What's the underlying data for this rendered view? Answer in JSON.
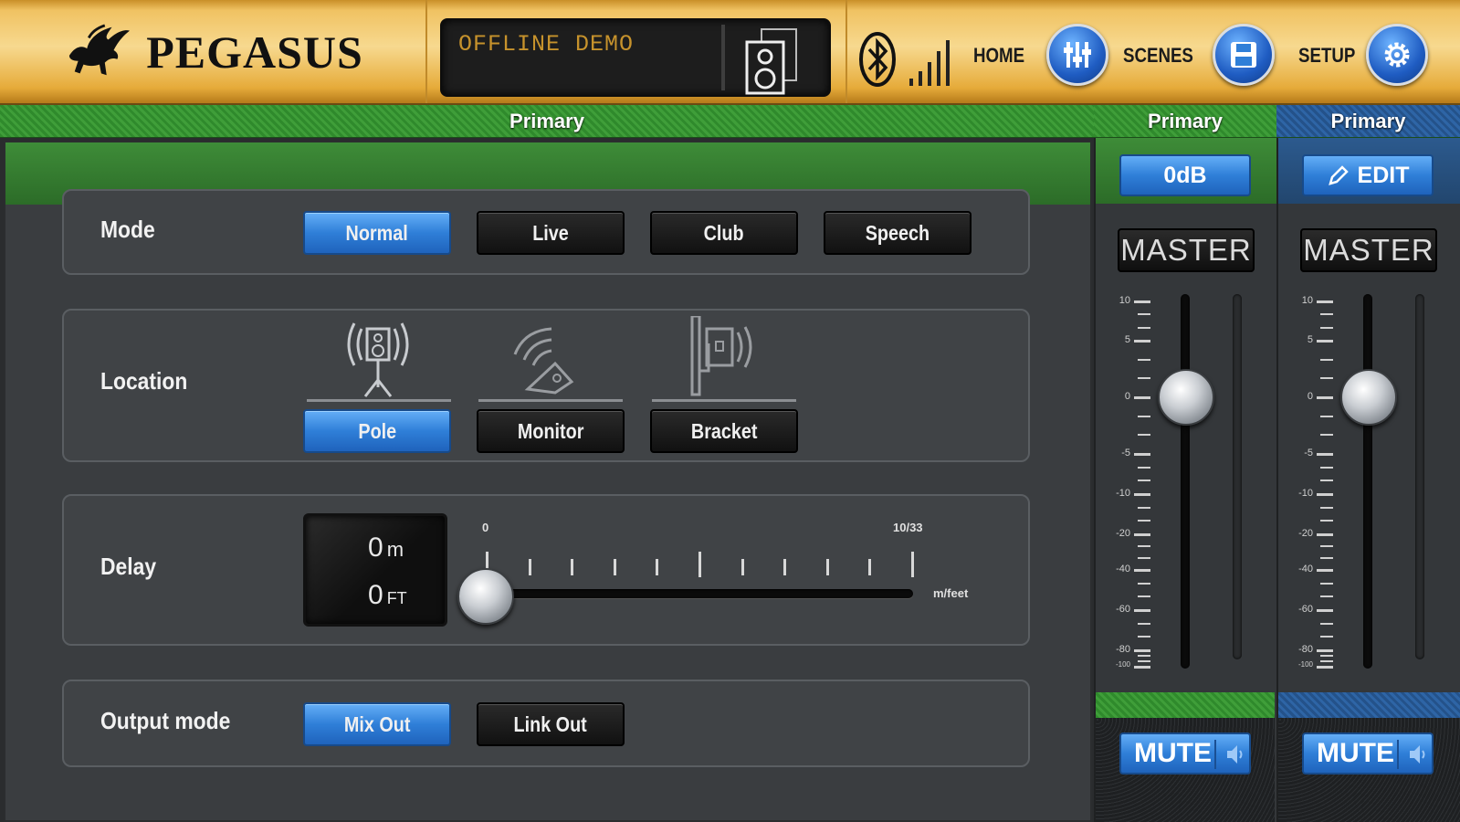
{
  "header": {
    "brand": "PEGASUS",
    "status": "OFFLINE DEMO",
    "nav": [
      {
        "label": "HOME",
        "icon": "faders-icon"
      },
      {
        "label": "SCENES",
        "icon": "floppy-icon"
      },
      {
        "label": "SETUP",
        "icon": "gear-icon"
      }
    ]
  },
  "channels": {
    "main_label": "Primary",
    "strip1_label": "Primary",
    "strip2_label": "Primary"
  },
  "sections": {
    "mode": {
      "label": "Mode",
      "options": [
        "Normal",
        "Live",
        "Club",
        "Speech"
      ],
      "selected": "Normal"
    },
    "location": {
      "label": "Location",
      "options": [
        "Pole",
        "Monitor",
        "Bracket"
      ],
      "selected": "Pole"
    },
    "delay": {
      "label": "Delay",
      "meters_value": "0",
      "meters_unit": "m",
      "feet_value": "0",
      "feet_unit": "FT",
      "slider_min": "0",
      "slider_max": "10/33",
      "slider_unit": "m/feet",
      "slider_value": 0
    },
    "output": {
      "label": "Output mode",
      "options": [
        "Mix Out",
        "Link Out"
      ],
      "selected": "Mix Out"
    }
  },
  "master_strips": [
    {
      "top_button": "0dB",
      "name": "MASTER",
      "mute": "MUTE",
      "fader_db": 0,
      "color": "#3f9e39"
    },
    {
      "top_button": "EDIT",
      "name": "MASTER",
      "mute": "MUTE",
      "fader_db": 0,
      "color": "#2e65a6"
    }
  ],
  "fader_scale": [
    "10",
    "5",
    "0",
    "-5",
    "-10",
    "-20",
    "-40",
    "-60",
    "-80",
    "-100"
  ],
  "colors": {
    "accent_blue": "#2f7fd8",
    "header_gold": "#f0c262",
    "channel_green": "#3f9e39",
    "status_amber": "#c6922c"
  }
}
